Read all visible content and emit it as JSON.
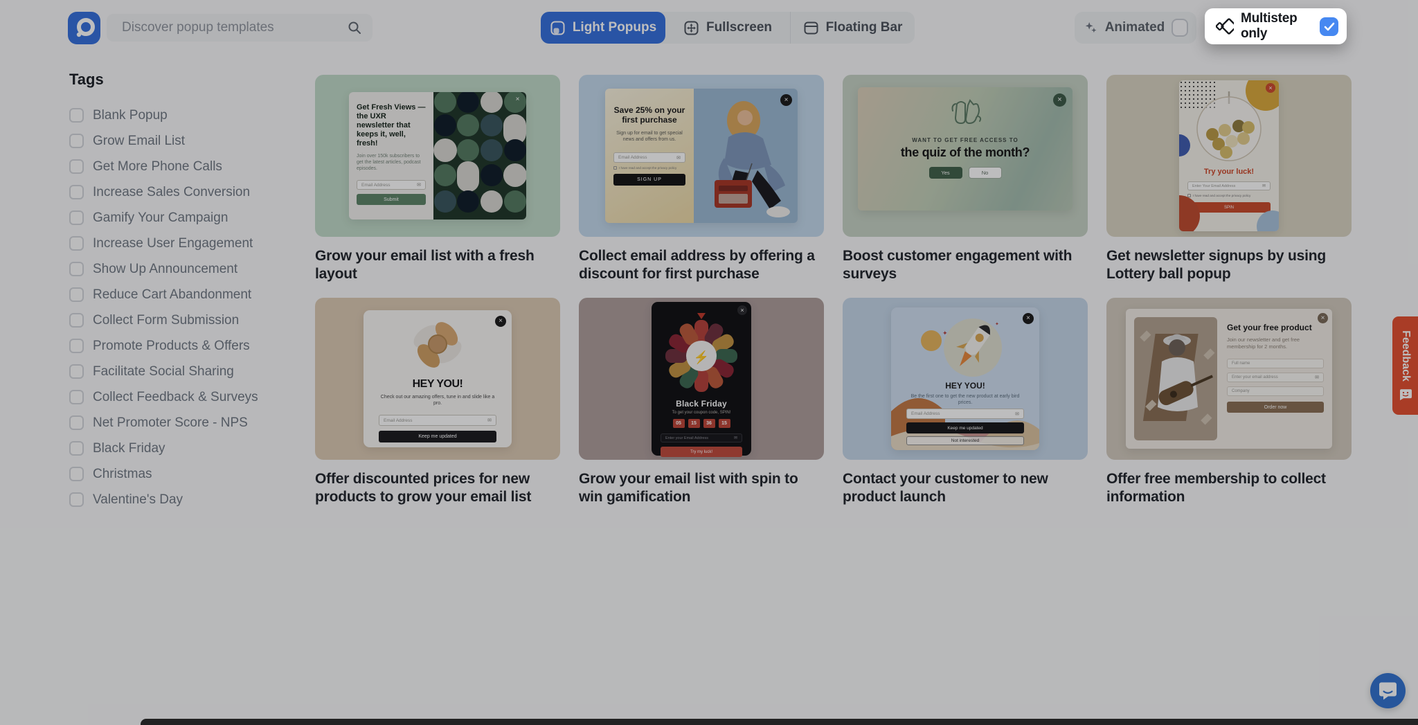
{
  "header": {
    "search": {
      "placeholder": "Discover popup templates"
    },
    "tabs": [
      {
        "label": "Light Popups",
        "active": true
      },
      {
        "label": "Fullscreen",
        "active": false
      },
      {
        "label": "Floating Bar",
        "active": false
      }
    ],
    "animated_label": "Animated",
    "animated_checked": false,
    "multistep_label": "Multistep only",
    "multistep_checked": true
  },
  "sidebar": {
    "title": "Tags",
    "items": [
      "Blank Popup",
      "Grow Email List",
      "Get More Phone Calls",
      "Increase Sales Conversion",
      "Gamify Your Campaign",
      "Increase User Engagement",
      "Show Up Announcement",
      "Reduce Cart Abandonment",
      "Collect Form Submission",
      "Promote Products & Offers",
      "Facilitate Social Sharing",
      "Collect Feedback & Surveys",
      "Net Promoter Score - NPS",
      "Black Friday",
      "Christmas",
      "Valentine's Day"
    ]
  },
  "cards": [
    {
      "title": "Grow your email list with a fresh layout",
      "preview": {
        "heading": "Get Fresh Views — the UXR newsletter that keeps it, well, fresh!",
        "body": "Join over 150k subscribers to get the latest articles, podcast episodes.",
        "input_placeholder": "Email Address",
        "button": "Submit"
      }
    },
    {
      "title": "Collect email address by offering a discount for first purchase",
      "preview": {
        "heading": "Save 25% on your first purchase",
        "body": "Sign up for email to get special news and offers from us.",
        "input_placeholder": "Email Address",
        "consent": "I have read and accept the privacy policy",
        "button": "SIGN UP"
      }
    },
    {
      "title": "Boost customer engagement with surveys",
      "preview": {
        "eyebrow": "WANT TO GET FREE ACCESS TO",
        "heading": "the quiz of the month?",
        "yes": "Yes",
        "no": "No"
      }
    },
    {
      "title": "Get newsletter signups by using Lottery ball popup",
      "preview": {
        "heading": "Try your luck!",
        "input_placeholder": "Enter Your Email Address",
        "consent": "I have read and accept the privacy policy",
        "button": "SPIN"
      }
    },
    {
      "title": "Offer discounted prices for new products to grow your email list",
      "preview": {
        "heading": "HEY YOU!",
        "body": "Check out our amazing offers, tune in and slide like a pro.",
        "input_placeholder": "Email Address",
        "button": "Keep me updated"
      }
    },
    {
      "title": "Grow your email list with spin to win gamification",
      "preview": {
        "heading": "Black Friday",
        "body": "To get your coupon code, SPIN!",
        "countdown": [
          "05",
          "15",
          "36",
          "15"
        ],
        "input_placeholder": "Enter your Email Address",
        "button": "Try my luck!"
      }
    },
    {
      "title": "Contact your customer to new product launch",
      "preview": {
        "heading": "HEY YOU!",
        "body": "Be the first one to get the new product at early bird prices.",
        "input_placeholder": "Email Address",
        "button": "Keep me updated",
        "secondary": "Not interested"
      }
    },
    {
      "title": "Offer free membership to collect information",
      "preview": {
        "heading": "Get your free product",
        "body": "Join our newsletter and get free membership for 2 months.",
        "inputs": [
          "Full name",
          "Enter your email address",
          "Company"
        ],
        "button": "Order now"
      }
    }
  ],
  "feedback_label": "Feedback",
  "glyphs": {
    "close": "×",
    "bolt": "⚡"
  },
  "colors": {
    "accent_blue": "#3570dd",
    "checkbox_blue": "#4688f1",
    "feedback_orange": "#e44f2f",
    "chat_blue": "#3272cf"
  }
}
